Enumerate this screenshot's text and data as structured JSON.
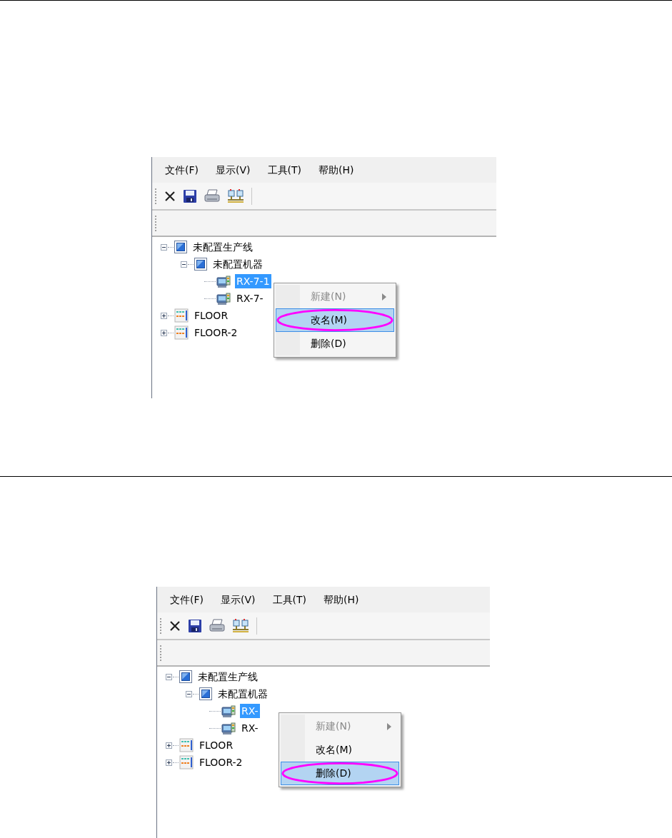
{
  "panels": [
    {
      "menu": [
        "文件(F)",
        "显示(V)",
        "工具(T)",
        "帮助(H)"
      ],
      "tree": [
        {
          "label": "未配置生产线",
          "kind": "line",
          "expanded": true,
          "selected": false,
          "children": [
            {
              "label": "未配置机器",
              "kind": "machine",
              "expanded": true,
              "selected": false,
              "children": [
                {
                  "label": "RX-7-1",
                  "kind": "device",
                  "selected": true
                },
                {
                  "label": "RX-7-",
                  "kind": "device",
                  "selected": false
                }
              ]
            }
          ]
        },
        {
          "label": "FLOOR",
          "kind": "floor",
          "expanded": false,
          "selected": false
        },
        {
          "label": "FLOOR-2",
          "kind": "floor",
          "expanded": false,
          "selected": false
        }
      ],
      "context_menu": [
        {
          "label": "新建(N)",
          "disabled": true,
          "submenu": true,
          "selected": false
        },
        {
          "label": "改名(M)",
          "disabled": false,
          "submenu": false,
          "selected": true
        },
        {
          "label": "删除(D)",
          "disabled": false,
          "submenu": false,
          "selected": false
        }
      ]
    },
    {
      "menu": [
        "文件(F)",
        "显示(V)",
        "工具(T)",
        "帮助(H)"
      ],
      "tree": [
        {
          "label": "未配置生产线",
          "kind": "line",
          "expanded": true,
          "selected": false,
          "children": [
            {
              "label": "未配置机器",
              "kind": "machine",
              "expanded": true,
              "selected": false,
              "children": [
                {
                  "label": "RX-",
                  "kind": "device",
                  "selected": true
                },
                {
                  "label": "RX-",
                  "kind": "device",
                  "selected": false
                }
              ]
            }
          ]
        },
        {
          "label": "FLOOR",
          "kind": "floor",
          "expanded": false,
          "selected": false
        },
        {
          "label": "FLOOR-2",
          "kind": "floor",
          "expanded": false,
          "selected": false
        }
      ],
      "context_menu": [
        {
          "label": "新建(N)",
          "disabled": true,
          "submenu": true,
          "selected": false
        },
        {
          "label": "改名(M)",
          "disabled": false,
          "submenu": false,
          "selected": false
        },
        {
          "label": "删除(D)",
          "disabled": false,
          "submenu": false,
          "selected": true
        }
      ]
    }
  ]
}
